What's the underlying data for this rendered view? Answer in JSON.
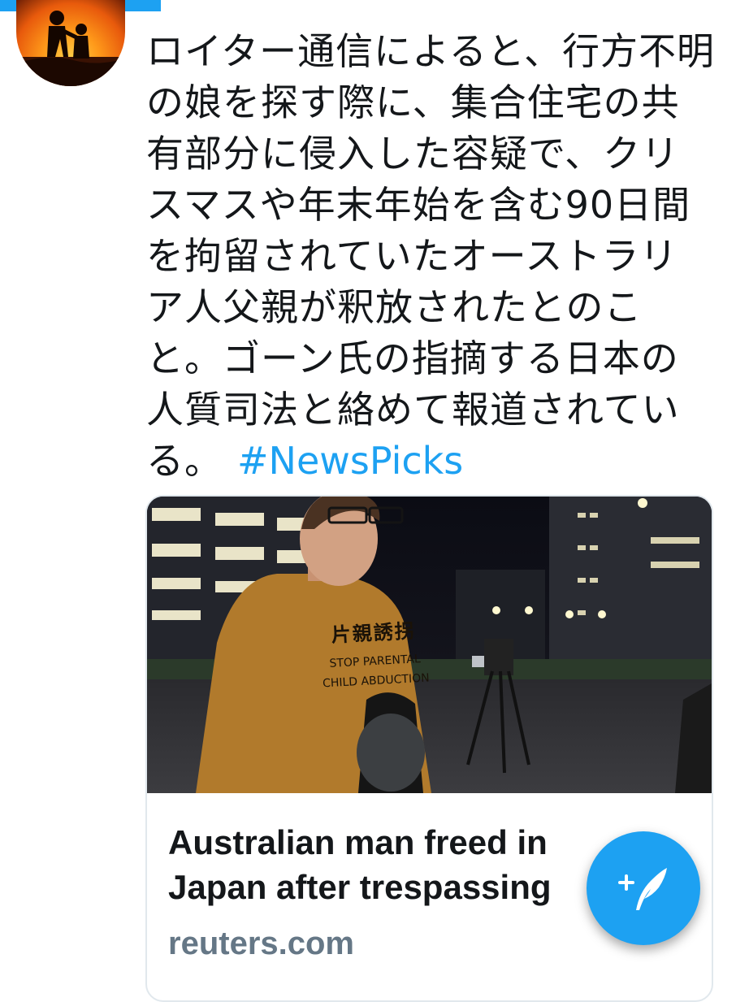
{
  "tweet": {
    "text": "ロイター通信によると、行方不明の娘を探す際に、集合住宅の共有部分に侵入した容疑で、クリスマスや年末年始を含む90日間を拘留されていたオーストラリア人父親が釈放されたとのこと。ゴーン氏の指摘する日本の人質司法と絡めて報道されている。",
    "hashtag": "#NewsPicks"
  },
  "card": {
    "image_shirt_text": {
      "kanji": "片親誘拐",
      "line1": "STOP PARENTAL",
      "line2": "CHILD ABDUCTION"
    },
    "headline_line1": "Australian man freed in",
    "headline_line2": "Japan after trespassing",
    "domain": "reuters.com"
  },
  "fab": {
    "icon": "compose-tweet-icon"
  },
  "colors": {
    "accent": "#1da1f2",
    "text": "#14171a",
    "muted": "#657786",
    "border": "#e1e8ed"
  }
}
